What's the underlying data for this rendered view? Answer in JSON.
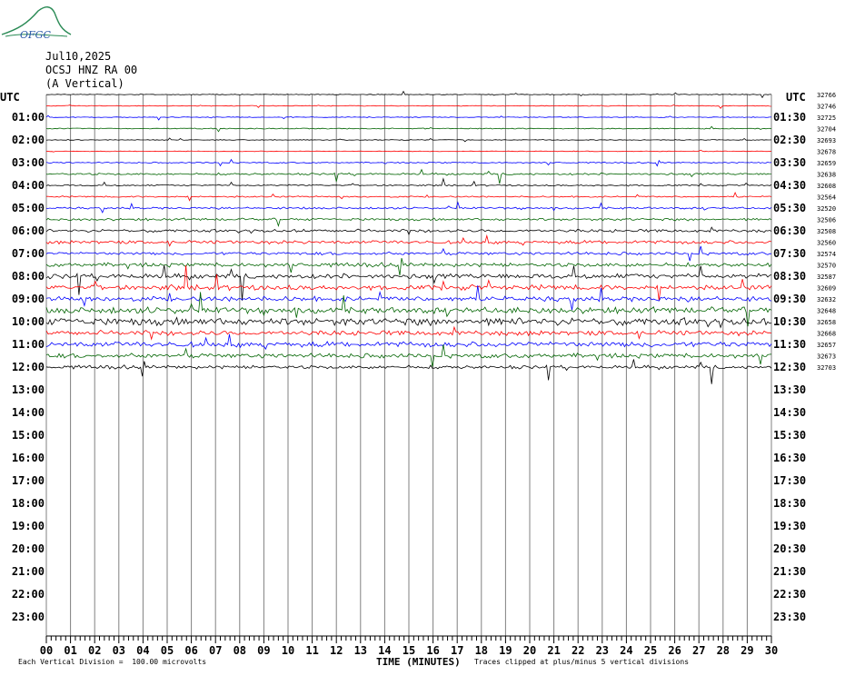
{
  "logo_text": "OFGC",
  "header": {
    "date": "Jul10,2025",
    "station": "OCSJ HNZ RA 00",
    "component": "(A Vertical)"
  },
  "utc_label_left": "UTC",
  "utc_label_right": "UTC",
  "footer": {
    "division": "Each Vertical Division =  100.00 microvolts",
    "xlabel": "TIME (MINUTES)",
    "clip": "Traces clipped at plus/minus 5 vertical divisions"
  },
  "colors": {
    "black": "#000000",
    "red": "#ff0000",
    "blue": "#0000ff",
    "green": "#006400",
    "grid": "#808080"
  },
  "chart_data": {
    "type": "line",
    "title": "OCSJ HNZ RA 00 (A Vertical)",
    "xlabel": "TIME (MINUTES)",
    "xlim": [
      0,
      30
    ],
    "x_ticks": [
      "00",
      "01",
      "02",
      "03",
      "04",
      "05",
      "06",
      "07",
      "08",
      "09",
      "10",
      "11",
      "12",
      "13",
      "14",
      "15",
      "16",
      "17",
      "18",
      "19",
      "20",
      "21",
      "22",
      "23",
      "24",
      "25",
      "26",
      "27",
      "28",
      "29",
      "30"
    ],
    "left_hour_labels": [
      "01:00",
      "02:00",
      "03:00",
      "04:00",
      "05:00",
      "06:00",
      "07:00",
      "08:00",
      "09:00",
      "10:00",
      "11:00",
      "12:00",
      "13:00",
      "14:00",
      "15:00",
      "16:00",
      "17:00",
      "18:00",
      "19:00",
      "20:00",
      "21:00",
      "22:00",
      "23:00"
    ],
    "right_hour_labels": [
      "01:30",
      "02:30",
      "03:30",
      "04:30",
      "05:30",
      "06:30",
      "07:30",
      "08:30",
      "09:30",
      "10:30",
      "11:30",
      "12:30",
      "13:30",
      "14:30",
      "15:30",
      "16:30",
      "17:30",
      "18:30",
      "19:30",
      "20:30",
      "21:30",
      "22:30",
      "23:30"
    ],
    "trace_offsets": [
      "32766",
      "32746",
      "32725",
      "32704",
      "32693",
      "32678",
      "32659",
      "32638",
      "32608",
      "32564",
      "32520",
      "32506",
      "32508",
      "32560",
      "32574",
      "32570",
      "32587",
      "32609",
      "32632",
      "32648",
      "32658",
      "32668",
      "32657",
      "32673",
      "32703"
    ],
    "trace_colors": [
      "black",
      "red",
      "blue",
      "green"
    ],
    "traces": [
      {
        "row": 0,
        "amp": 0.3
      },
      {
        "row": 1,
        "amp": 0.3
      },
      {
        "row": 2,
        "amp": 0.3
      },
      {
        "row": 3,
        "amp": 0.4
      },
      {
        "row": 4,
        "amp": 0.3
      },
      {
        "row": 5,
        "amp": 0.3
      },
      {
        "row": 6,
        "amp": 0.5
      },
      {
        "row": 7,
        "amp": 0.8
      },
      {
        "row": 8,
        "amp": 0.6
      },
      {
        "row": 9,
        "amp": 0.6
      },
      {
        "row": 10,
        "amp": 0.8
      },
      {
        "row": 11,
        "amp": 1.0
      },
      {
        "row": 12,
        "amp": 1.2
      },
      {
        "row": 13,
        "amp": 1.4
      },
      {
        "row": 14,
        "amp": 1.2
      },
      {
        "row": 15,
        "amp": 1.6
      },
      {
        "row": 16,
        "amp": 2.0
      },
      {
        "row": 17,
        "amp": 2.0
      },
      {
        "row": 18,
        "amp": 2.0
      },
      {
        "row": 19,
        "amp": 2.5
      },
      {
        "row": 20,
        "amp": 3.0
      },
      {
        "row": 21,
        "amp": 2.0
      },
      {
        "row": 22,
        "amp": 2.2
      },
      {
        "row": 23,
        "amp": 1.8
      },
      {
        "row": 24,
        "amp": 1.4
      }
    ]
  }
}
